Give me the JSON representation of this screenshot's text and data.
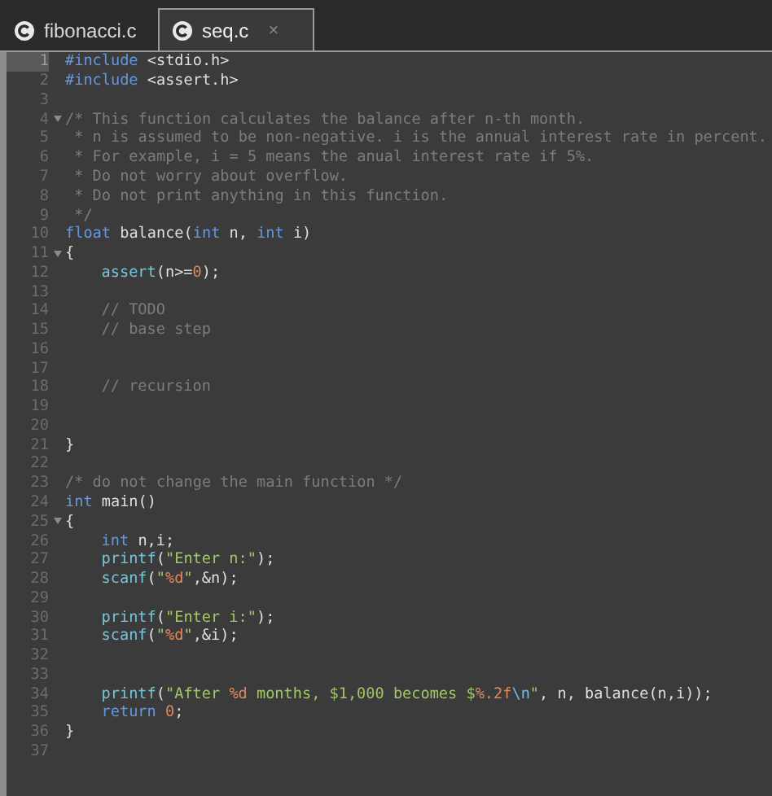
{
  "tabs": [
    {
      "label": "fibonacci.c",
      "selected": false
    },
    {
      "label": "seq.c",
      "selected": true,
      "close": "×"
    }
  ],
  "lines": [
    {
      "number": "1",
      "active": true,
      "tokens": [
        {
          "kind": "keyword",
          "text": "#include"
        },
        {
          "kind": "plain",
          "text": " <stdio.h>"
        }
      ]
    },
    {
      "number": "2",
      "tokens": [
        {
          "kind": "keyword",
          "text": "#include"
        },
        {
          "kind": "plain",
          "text": " <assert.h>"
        }
      ]
    },
    {
      "number": "3"
    },
    {
      "number": "4",
      "foldable": true,
      "tokens": [
        {
          "kind": "comment",
          "text": "/* This function calculates the balance after n-th month."
        }
      ]
    },
    {
      "number": "5",
      "tokens": [
        {
          "kind": "comment",
          "text": " * n is assumed to be non-negative. i is the annual interest rate in percent."
        }
      ]
    },
    {
      "number": "6",
      "tokens": [
        {
          "kind": "comment",
          "text": " * For example, i = 5 means the anual interest rate if 5%."
        }
      ]
    },
    {
      "number": "7",
      "tokens": [
        {
          "kind": "comment",
          "text": " * Do not worry about overflow."
        }
      ]
    },
    {
      "number": "8",
      "tokens": [
        {
          "kind": "comment",
          "text": " * Do not print anything in this function."
        }
      ]
    },
    {
      "number": "9",
      "tokens": [
        {
          "kind": "comment",
          "text": " */"
        }
      ]
    },
    {
      "number": "10",
      "tokens": [
        {
          "kind": "keyword",
          "text": "float"
        },
        {
          "kind": "plain",
          "text": " balance("
        },
        {
          "kind": "keyword",
          "text": "int"
        },
        {
          "kind": "plain",
          "text": " n, "
        },
        {
          "kind": "keyword",
          "text": "int"
        },
        {
          "kind": "plain",
          "text": " i)"
        }
      ]
    },
    {
      "number": "11",
      "foldable": true,
      "tokens": [
        {
          "kind": "plain",
          "text": "{"
        }
      ]
    },
    {
      "number": "12",
      "indented": true,
      "tokens": [
        {
          "kind": "function",
          "text": "assert"
        },
        {
          "kind": "plain",
          "text": "(n>="
        },
        {
          "kind": "number",
          "text": "0"
        },
        {
          "kind": "plain",
          "text": ");"
        }
      ]
    },
    {
      "number": "13"
    },
    {
      "number": "14",
      "indented": true,
      "tokens": [
        {
          "kind": "comment",
          "text": "// TODO"
        }
      ]
    },
    {
      "number": "15",
      "indented": true,
      "tokens": [
        {
          "kind": "comment",
          "text": "// base step"
        }
      ]
    },
    {
      "number": "16"
    },
    {
      "number": "17"
    },
    {
      "number": "18",
      "indented": true,
      "tokens": [
        {
          "kind": "comment",
          "text": "// recursion"
        }
      ]
    },
    {
      "number": "19"
    },
    {
      "number": "20"
    },
    {
      "number": "21",
      "tokens": [
        {
          "kind": "plain",
          "text": "}"
        }
      ]
    },
    {
      "number": "22"
    },
    {
      "number": "23",
      "tokens": [
        {
          "kind": "comment",
          "text": "/* do not change the main function */"
        }
      ]
    },
    {
      "number": "24",
      "tokens": [
        {
          "kind": "keyword",
          "text": "int"
        },
        {
          "kind": "plain",
          "text": " main()"
        }
      ]
    },
    {
      "number": "25",
      "foldable": true,
      "tokens": [
        {
          "kind": "plain",
          "text": "{"
        }
      ]
    },
    {
      "number": "26",
      "indented": true,
      "tokens": [
        {
          "kind": "keyword",
          "text": "int"
        },
        {
          "kind": "plain",
          "text": " n,i;"
        }
      ]
    },
    {
      "number": "27",
      "indented": true,
      "tokens": [
        {
          "kind": "function",
          "text": "printf"
        },
        {
          "kind": "plain",
          "text": "("
        },
        {
          "kind": "string",
          "text": "\"Enter n:\""
        },
        {
          "kind": "plain",
          "text": ");"
        }
      ]
    },
    {
      "number": "28",
      "indented": true,
      "tokens": [
        {
          "kind": "function",
          "text": "scanf"
        },
        {
          "kind": "plain",
          "text": "("
        },
        {
          "kind": "string",
          "text": "\""
        },
        {
          "kind": "number",
          "text": "%d"
        },
        {
          "kind": "string",
          "text": "\""
        },
        {
          "kind": "plain",
          "text": ",&n);"
        }
      ]
    },
    {
      "number": "29"
    },
    {
      "number": "30",
      "indented": true,
      "tokens": [
        {
          "kind": "function",
          "text": "printf"
        },
        {
          "kind": "plain",
          "text": "("
        },
        {
          "kind": "string",
          "text": "\"Enter i:\""
        },
        {
          "kind": "plain",
          "text": ");"
        }
      ]
    },
    {
      "number": "31",
      "indented": true,
      "tokens": [
        {
          "kind": "function",
          "text": "scanf"
        },
        {
          "kind": "plain",
          "text": "("
        },
        {
          "kind": "string",
          "text": "\""
        },
        {
          "kind": "number",
          "text": "%d"
        },
        {
          "kind": "string",
          "text": "\""
        },
        {
          "kind": "plain",
          "text": ",&i);"
        }
      ]
    },
    {
      "number": "32"
    },
    {
      "number": "33"
    },
    {
      "number": "34",
      "indented": true,
      "tokens": [
        {
          "kind": "function",
          "text": "printf"
        },
        {
          "kind": "plain",
          "text": "("
        },
        {
          "kind": "string",
          "text": "\"After "
        },
        {
          "kind": "number",
          "text": "%d"
        },
        {
          "kind": "string",
          "text": " months, $1,000 becomes $"
        },
        {
          "kind": "number",
          "text": "%.2f"
        },
        {
          "kind": "escape",
          "text": "\\n"
        },
        {
          "kind": "string",
          "text": "\""
        },
        {
          "kind": "plain",
          "text": ", n, balance(n,i));"
        }
      ]
    },
    {
      "number": "35",
      "indented": true,
      "tokens": [
        {
          "kind": "keyword",
          "text": "return "
        },
        {
          "kind": "number",
          "text": "0"
        },
        {
          "kind": "plain",
          "text": ";"
        }
      ]
    },
    {
      "number": "36",
      "tokens": [
        {
          "kind": "plain",
          "text": "}"
        }
      ]
    },
    {
      "number": "37"
    }
  ]
}
